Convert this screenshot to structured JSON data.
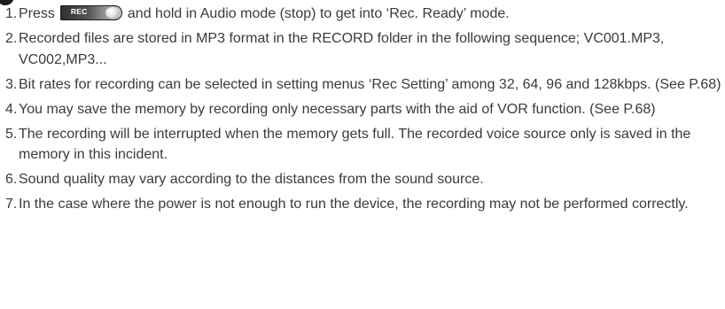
{
  "instructions": [
    {
      "number": "1.",
      "text_before": "Press",
      "button_label": "REC",
      "text_after": "and hold in Audio mode (stop) to get into ‘Rec. Ready’ mode."
    },
    {
      "number": "2.",
      "text": "Recorded files are stored in MP3 format in the RECORD folder in the following sequence; VC001.MP3, VC002,MP3..."
    },
    {
      "number": "3.",
      "text": "Bit rates for recording can be selected in setting menus ‘Rec Setting’ among 32, 64, 96 and 128kbps. (See P.68)"
    },
    {
      "number": "4.",
      "text": "You may save the memory by recording only necessary parts with the aid of VOR function. (See P.68)"
    },
    {
      "number": "5.",
      "text": "The recording will be interrupted when the memory gets full. The recorded voice source only is saved in the memory in this incident."
    },
    {
      "number": "6.",
      "text": "Sound quality may vary according to the distances from the sound source."
    },
    {
      "number": "7.",
      "text": "In the case where the power is not enough to run the device, the recording may not be performed correctly."
    }
  ]
}
